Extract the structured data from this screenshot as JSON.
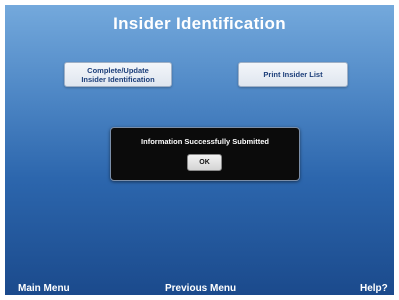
{
  "header": {
    "title": "Insider Identification"
  },
  "actions": {
    "complete_update_line1": "Complete/Update",
    "complete_update_line2": "Insider Identification",
    "print_list": "Print Insider List"
  },
  "dialog": {
    "message": "Information Successfully Submitted",
    "ok_label": "OK"
  },
  "footer": {
    "main_menu": "Main Menu",
    "previous_menu": "Previous Menu",
    "help": "Help?"
  },
  "colors": {
    "background_top": "#74a9dc",
    "background_bottom": "#1b4a8c",
    "button_text": "#1d3f7a",
    "dialog_background": "#0b0b0b"
  }
}
